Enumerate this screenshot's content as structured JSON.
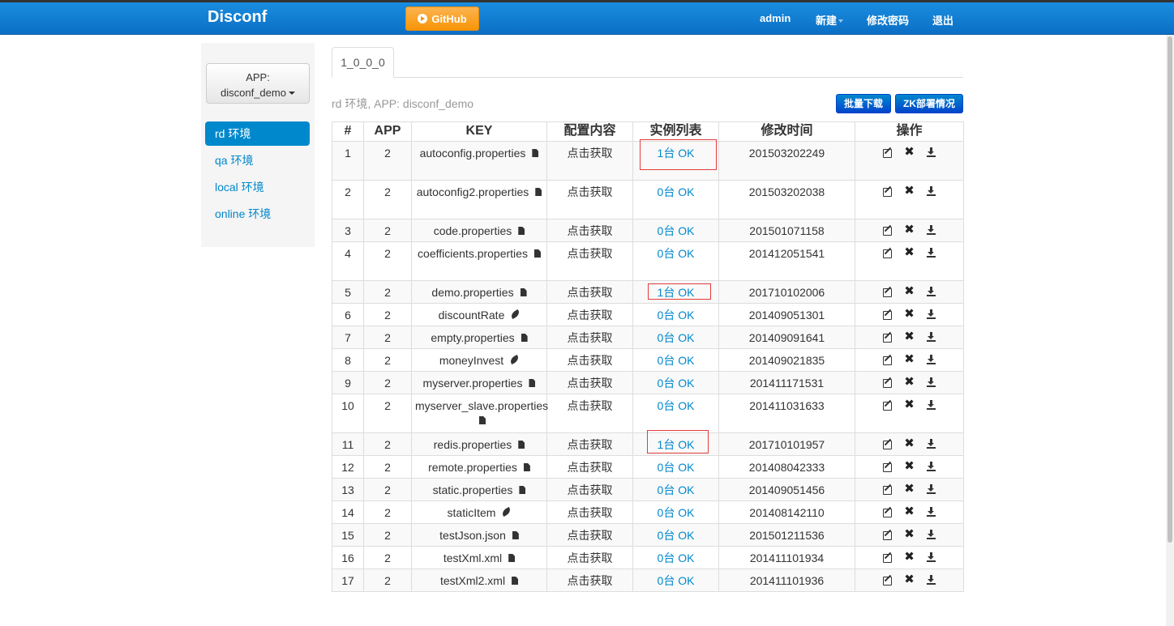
{
  "navbar": {
    "brand": "Disconf",
    "github_label": "GitHub",
    "user": "admin",
    "new_label": "新建",
    "change_password": "修改密码",
    "logout": "退出"
  },
  "sidebar": {
    "app_prefix": "APP:",
    "app_name": "disconf_demo",
    "envs": [
      "rd 环境",
      "qa 环境",
      "local 环境",
      "online 环境"
    ],
    "active_env": "rd 环境"
  },
  "main": {
    "version_tab": "1_0_0_0",
    "env_info": "rd 环境, APP: disconf_demo",
    "batch_download": "批量下载",
    "zk_status": "ZK部署情况",
    "table": {
      "headers": [
        "#",
        "APP",
        "KEY",
        "配置内容",
        "实例列表",
        "修改时间",
        "操作"
      ],
      "rows": [
        {
          "id": "1",
          "app": "2",
          "key": "autoconfig.properties",
          "type": "file",
          "content": "点击获取",
          "instances": "1台 OK",
          "time": "201503202249"
        },
        {
          "id": "2",
          "app": "2",
          "key": "autoconfig2.properties",
          "type": "file",
          "content": "点击获取",
          "instances": "0台 OK",
          "time": "201503202038"
        },
        {
          "id": "3",
          "app": "2",
          "key": "code.properties",
          "type": "file",
          "content": "点击获取",
          "instances": "0台 OK",
          "time": "201501071158"
        },
        {
          "id": "4",
          "app": "2",
          "key": "coefficients.properties",
          "type": "file",
          "content": "点击获取",
          "instances": "0台 OK",
          "time": "201412051541"
        },
        {
          "id": "5",
          "app": "2",
          "key": "demo.properties",
          "type": "file",
          "content": "点击获取",
          "instances": "1台 OK",
          "time": "201710102006"
        },
        {
          "id": "6",
          "app": "2",
          "key": "discountRate",
          "type": "item",
          "content": "点击获取",
          "instances": "0台 OK",
          "time": "201409051301"
        },
        {
          "id": "7",
          "app": "2",
          "key": "empty.properties",
          "type": "file",
          "content": "点击获取",
          "instances": "0台 OK",
          "time": "201409091641"
        },
        {
          "id": "8",
          "app": "2",
          "key": "moneyInvest",
          "type": "item",
          "content": "点击获取",
          "instances": "0台 OK",
          "time": "201409021835"
        },
        {
          "id": "9",
          "app": "2",
          "key": "myserver.properties",
          "type": "file",
          "content": "点击获取",
          "instances": "0台 OK",
          "time": "201411171531"
        },
        {
          "id": "10",
          "app": "2",
          "key": "myserver_slave.properties",
          "type": "file",
          "content": "点击获取",
          "instances": "0台 OK",
          "time": "201411031633"
        },
        {
          "id": "11",
          "app": "2",
          "key": "redis.properties",
          "type": "file",
          "content": "点击获取",
          "instances": "1台 OK",
          "time": "201710101957"
        },
        {
          "id": "12",
          "app": "2",
          "key": "remote.properties",
          "type": "file",
          "content": "点击获取",
          "instances": "0台 OK",
          "time": "201408042333"
        },
        {
          "id": "13",
          "app": "2",
          "key": "static.properties",
          "type": "file",
          "content": "点击获取",
          "instances": "0台 OK",
          "time": "201409051456"
        },
        {
          "id": "14",
          "app": "2",
          "key": "staticItem",
          "type": "item",
          "content": "点击获取",
          "instances": "0台 OK",
          "time": "201408142110"
        },
        {
          "id": "15",
          "app": "2",
          "key": "testJson.json",
          "type": "file",
          "content": "点击获取",
          "instances": "0台 OK",
          "time": "201501211536"
        },
        {
          "id": "16",
          "app": "2",
          "key": "testXml.xml",
          "type": "file",
          "content": "点击获取",
          "instances": "0台 OK",
          "time": "201411101934"
        },
        {
          "id": "17",
          "app": "2",
          "key": "testXml2.xml",
          "type": "file",
          "content": "点击获取",
          "instances": "0台 OK",
          "time": "201411101936"
        }
      ]
    }
  },
  "icons": {
    "file": "file-icon",
    "item": "leaf-icon",
    "edit": "edit-icon",
    "delete": "delete-icon",
    "download": "download-icon"
  },
  "colors": {
    "navbar": "#0b6fc4",
    "github": "#f89406",
    "link": "#0088cc",
    "highlight": "#e23c3c"
  }
}
